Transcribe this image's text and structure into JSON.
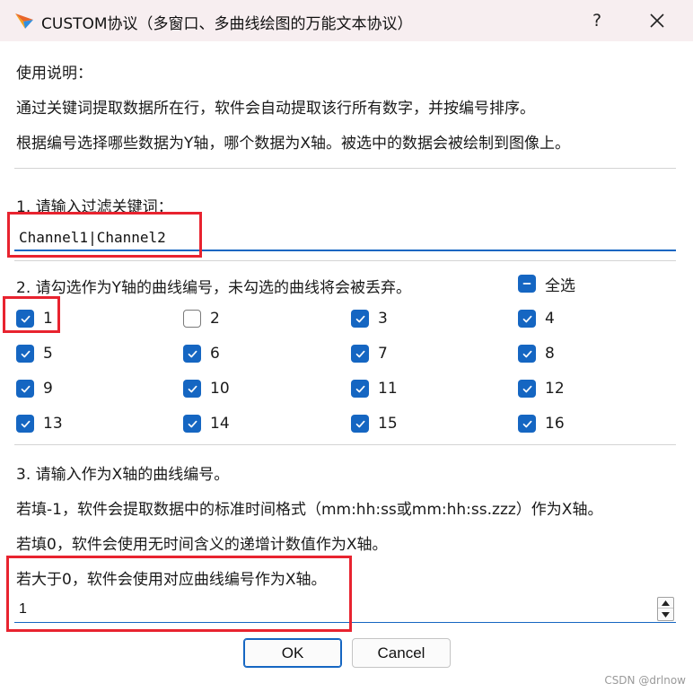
{
  "window": {
    "title": "CUSTOM协议（多窗口、多曲线绘图的万能文本协议）",
    "help_label": "?"
  },
  "instructions": {
    "heading": "使用说明：",
    "line1": "通过关键词提取数据所在行，软件会自动提取该行所有数字，并按编号排序。",
    "line2": "根据编号选择哪些数据为Y轴，哪个数据为X轴。被选中的数据会被绘制到图像上。"
  },
  "section1": {
    "label": "1. 请输入过滤关键词：",
    "keyword_value": "Channel1|Channel2"
  },
  "section2": {
    "label": "2. 请勾选作为Y轴的曲线编号，未勾选的曲线将会被丢弃。",
    "select_all_label": "全选",
    "curves": [
      {
        "label": "1",
        "checked": true
      },
      {
        "label": "2",
        "checked": false
      },
      {
        "label": "3",
        "checked": true
      },
      {
        "label": "4",
        "checked": true
      },
      {
        "label": "5",
        "checked": true
      },
      {
        "label": "6",
        "checked": true
      },
      {
        "label": "7",
        "checked": true
      },
      {
        "label": "8",
        "checked": true
      },
      {
        "label": "9",
        "checked": true
      },
      {
        "label": "10",
        "checked": true
      },
      {
        "label": "11",
        "checked": true
      },
      {
        "label": "12",
        "checked": true
      },
      {
        "label": "13",
        "checked": true
      },
      {
        "label": "14",
        "checked": true
      },
      {
        "label": "15",
        "checked": true
      },
      {
        "label": "16",
        "checked": true
      }
    ]
  },
  "section3": {
    "label": "3. 请输入作为X轴的曲线编号。",
    "hint1": "若填-1，软件会提取数据中的标准时间格式（mm:hh:ss或mm:hh:ss.zzz）作为X轴。",
    "hint2": "若填0，软件会使用无时间含义的递增计数值作为X轴。",
    "hint3": "若大于0，软件会使用对应曲线编号作为X轴。",
    "x_value": "1"
  },
  "buttons": {
    "ok": "OK",
    "cancel": "Cancel"
  },
  "watermark": "CSDN @drlnow",
  "colors": {
    "accent": "#1566c2",
    "highlight": "#e8232f",
    "titlebar": "#f7eef0"
  }
}
